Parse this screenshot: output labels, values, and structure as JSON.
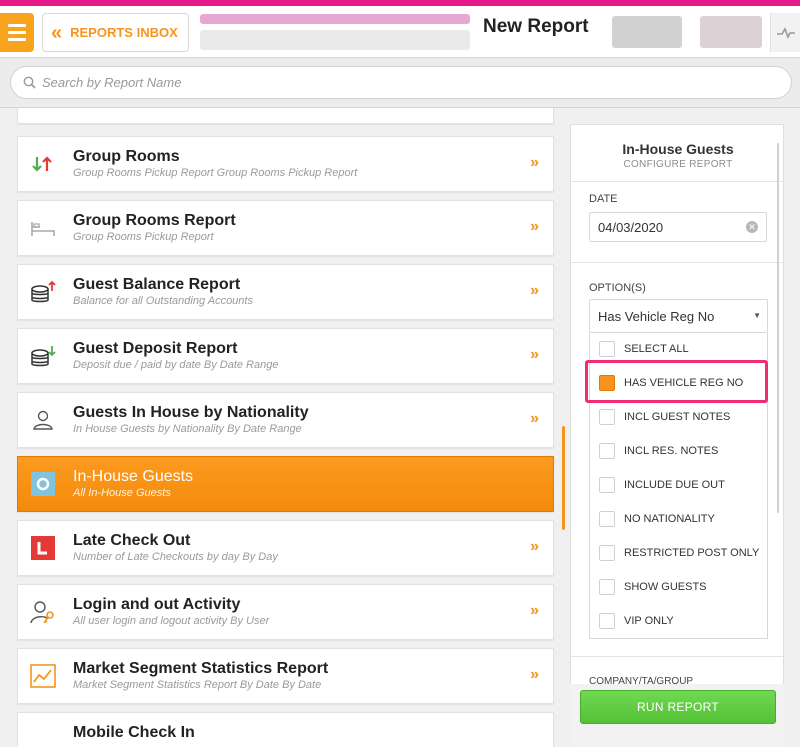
{
  "header": {
    "back_button": "REPORTS INBOX",
    "title": "New Report",
    "back_icon": "double-chevron-left-icon",
    "menu_icon": "hamburger-menu-icon",
    "right_icon": "activity-icon"
  },
  "search": {
    "placeholder": "Search by Report Name"
  },
  "reports": [
    {
      "title": "Group Rooms",
      "subtitle": "Group Rooms Pickup Report Group Rooms Pickup Report",
      "icon": "up-down-arrows-icon",
      "active": false
    },
    {
      "title": "Group Rooms Report",
      "subtitle": "Group Rooms Pickup Report",
      "icon": "bed-icon",
      "active": false
    },
    {
      "title": "Guest Balance Report",
      "subtitle": "Balance for all Outstanding Accounts",
      "icon": "coins-up-icon",
      "active": false
    },
    {
      "title": "Guest Deposit Report",
      "subtitle": "Deposit due / paid by date By Date Range",
      "icon": "coins-down-icon",
      "active": false
    },
    {
      "title": "Guests In House by Nationality",
      "subtitle": "In House Guests by Nationality By Date Range",
      "icon": "person-icon",
      "active": false
    },
    {
      "title": "In-House Guests",
      "subtitle": "All In-House Guests",
      "icon": "circle-icon",
      "active": true
    },
    {
      "title": "Late Check Out",
      "subtitle": "Number of Late Checkouts by day By Day",
      "icon": "letter-l-icon",
      "active": false
    },
    {
      "title": "Login and out Activity",
      "subtitle": "All user login and logout activity By User",
      "icon": "user-key-icon",
      "active": false
    },
    {
      "title": "Market Segment Statistics Report",
      "subtitle": "Market Segment Statistics Report By Date By Date",
      "icon": "line-chart-icon",
      "active": false
    },
    {
      "title": "Mobile Check In",
      "subtitle": "",
      "icon": "",
      "active": false
    }
  ],
  "config": {
    "title": "In-House Guests",
    "subtitle": "CONFIGURE REPORT",
    "date_label": "DATE",
    "date_value": "04/03/2020",
    "options_label": "OPTION(S)",
    "options_selected": "Has Vehicle Reg No",
    "options": [
      {
        "label": "SELECT ALL",
        "checked": false
      },
      {
        "label": "HAS VEHICLE REG NO",
        "checked": true
      },
      {
        "label": "INCL GUEST NOTES",
        "checked": false
      },
      {
        "label": "INCL RES. NOTES",
        "checked": false
      },
      {
        "label": "INCLUDE DUE OUT",
        "checked": false
      },
      {
        "label": "NO NATIONALITY",
        "checked": false
      },
      {
        "label": "RESTRICTED POST ONLY",
        "checked": false
      },
      {
        "label": "SHOW GUESTS",
        "checked": false
      },
      {
        "label": "VIP ONLY",
        "checked": false
      }
    ],
    "company_label": "COMPANY/TA/GROUP",
    "run_button": "RUN REPORT"
  },
  "colors": {
    "accent": "#f7941d",
    "header_stripe": "#e6198a",
    "highlight": "#ef2c76",
    "run_button": "#5ccb3d"
  }
}
